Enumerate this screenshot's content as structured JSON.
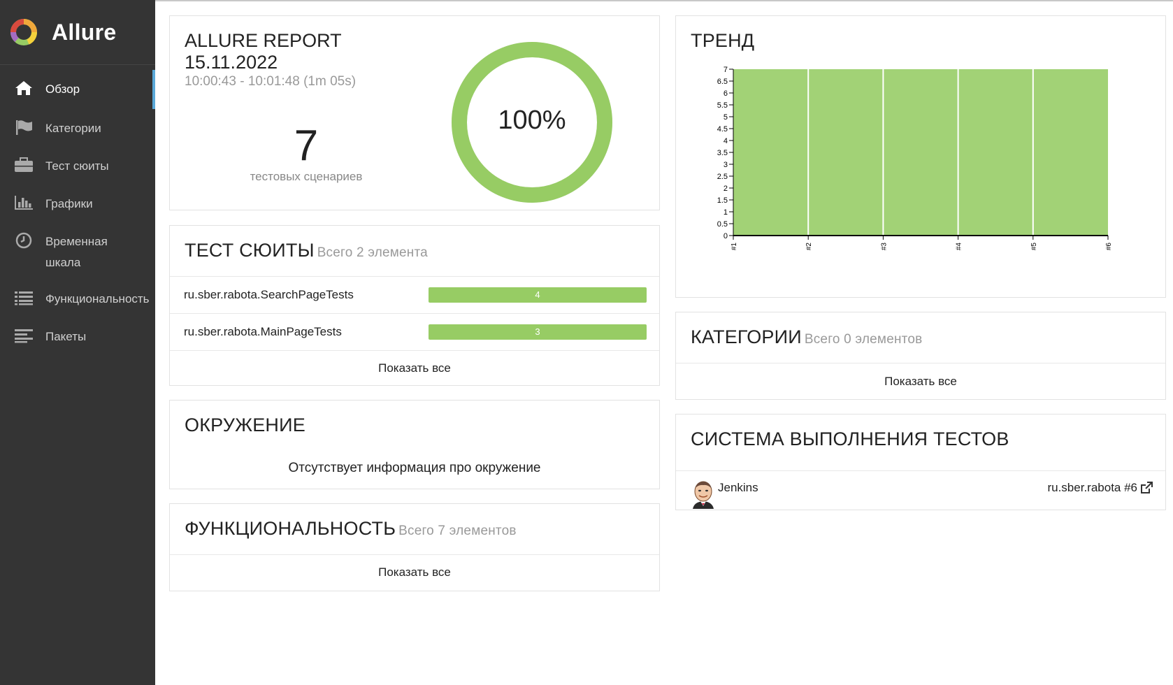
{
  "brand": {
    "name": "Allure"
  },
  "sidebar": {
    "items": [
      {
        "label": "Обзор",
        "icon": "home-icon",
        "active": true
      },
      {
        "label": "Категории",
        "icon": "flag-icon"
      },
      {
        "label": "Тест сюиты",
        "icon": "briefcase-icon"
      },
      {
        "label": "Графики",
        "icon": "bar-chart-icon"
      },
      {
        "label": "Временная шкала",
        "icon": "clock-icon"
      },
      {
        "label": "Функциональность",
        "icon": "list-icon"
      },
      {
        "label": "Пакеты",
        "icon": "align-left-icon"
      }
    ]
  },
  "summary": {
    "title": "ALLURE REPORT",
    "date": "15.11.2022",
    "time_range": "10:00:43 - 10:01:48 (1m 05s)",
    "test_count": "7",
    "test_count_label": "тестовых сценариев",
    "pass_percent": "100%",
    "pass_fraction": 1.0,
    "ring_color": "#97cc64"
  },
  "suites": {
    "title": "ТЕСТ СЮИТЫ",
    "subtitle": "Всего 2 элемента",
    "items": [
      {
        "name": "ru.sber.rabota.SearchPageTests",
        "count": "4"
      },
      {
        "name": "ru.sber.rabota.MainPageTests",
        "count": "3"
      }
    ],
    "show_all": "Показать все"
  },
  "environment": {
    "title": "ОКРУЖЕНИЕ",
    "empty_text": "Отсутствует информация про окружение"
  },
  "features": {
    "title": "ФУНКЦИОНАЛЬНОСТЬ",
    "subtitle": "Всего 7 элементов",
    "show_all": "Показать все"
  },
  "trend": {
    "title": "ТРЕНД"
  },
  "categories": {
    "title": "КАТЕГОРИИ",
    "subtitle": "Всего 0 элементов",
    "show_all": "Показать все"
  },
  "executors": {
    "title": "СИСТЕМА ВЫПОЛНЕНИЯ ТЕСТОВ",
    "name": "Jenkins",
    "build": "ru.sber.rabota #6",
    "icon": "jenkins-avatar-icon",
    "link_icon": "external-link-icon"
  },
  "chart_data": {
    "type": "area",
    "x": [
      "#1",
      "#2",
      "#3",
      "#4",
      "#5",
      "#6"
    ],
    "series": [
      {
        "values": [
          7,
          7,
          7,
          7,
          7,
          7
        ],
        "color": "#a2d276"
      }
    ],
    "ylim": [
      0,
      7
    ],
    "yticks": [
      "0",
      "0.5",
      "1",
      "1.5",
      "2",
      "2.5",
      "3",
      "3.5",
      "4",
      "4.5",
      "5",
      "5.5",
      "6",
      "6.5",
      "7"
    ],
    "grid": false
  },
  "colors": {
    "passed": "#97cc64",
    "sidebar_bg": "#343434",
    "accent": "#5aa9d8"
  }
}
